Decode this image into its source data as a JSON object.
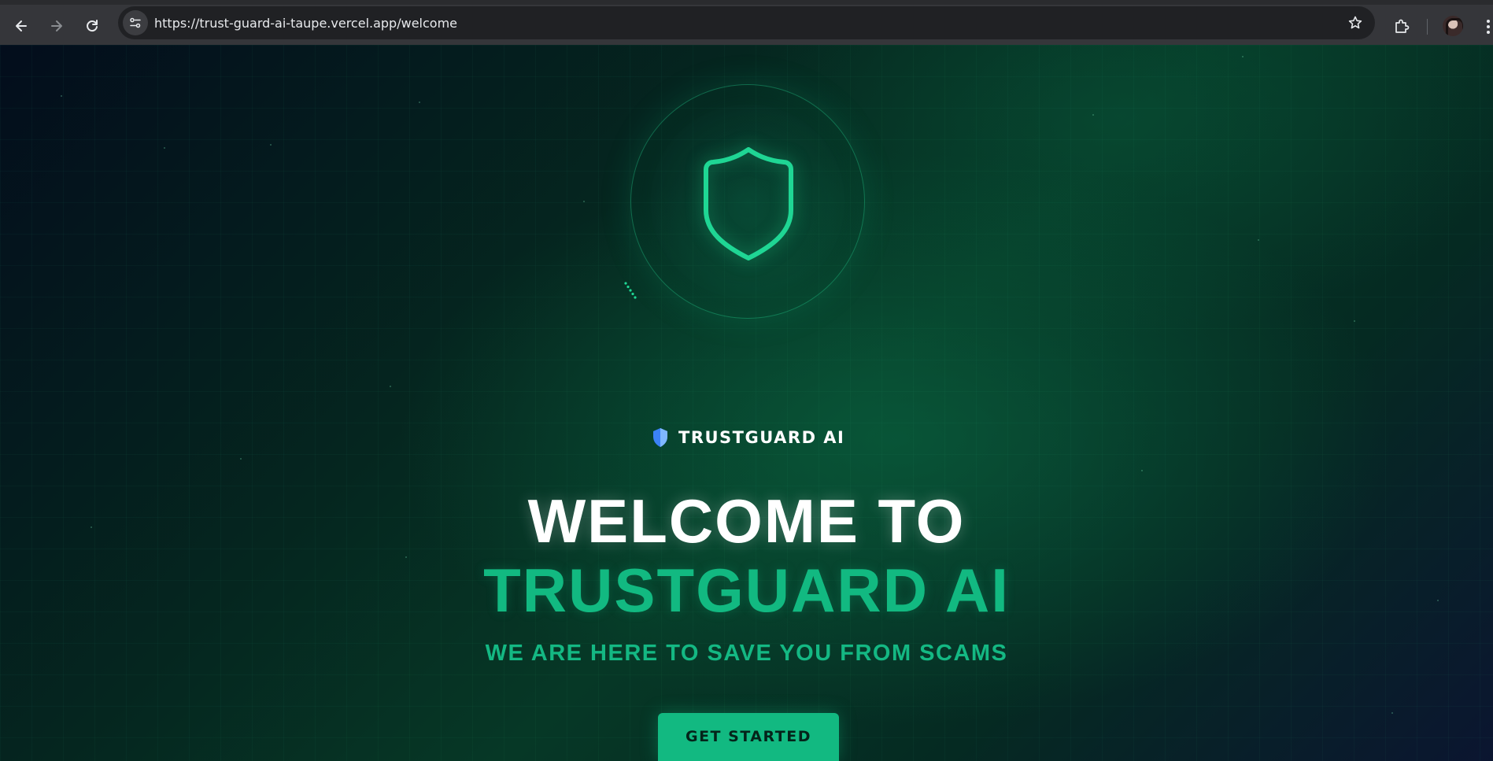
{
  "browser": {
    "url": "https://trust-guard-ai-taupe.vercel.app/welcome",
    "icons": {
      "back": "arrow-left-icon",
      "forward": "arrow-right-icon",
      "reload": "reload-icon",
      "site_info": "tune-icon",
      "bookmark": "star-icon",
      "extensions": "puzzle-icon",
      "menu": "kebab-menu-icon"
    }
  },
  "hero": {
    "icon": "shield-icon",
    "scan_icon": "scan-dots-icon"
  },
  "brand": {
    "icon": "shield-badge-icon",
    "name": "TRUSTGUARD AI"
  },
  "headline": {
    "line1": "WELCOME TO",
    "line2": "TRUSTGUARD AI"
  },
  "tagline": "WE ARE HERE TO SAVE YOU FROM SCAMS",
  "cta": {
    "label": "GET STARTED"
  },
  "colors": {
    "accent": "#12b981",
    "background": "#041318",
    "brand_shield": "#3b82f6"
  }
}
